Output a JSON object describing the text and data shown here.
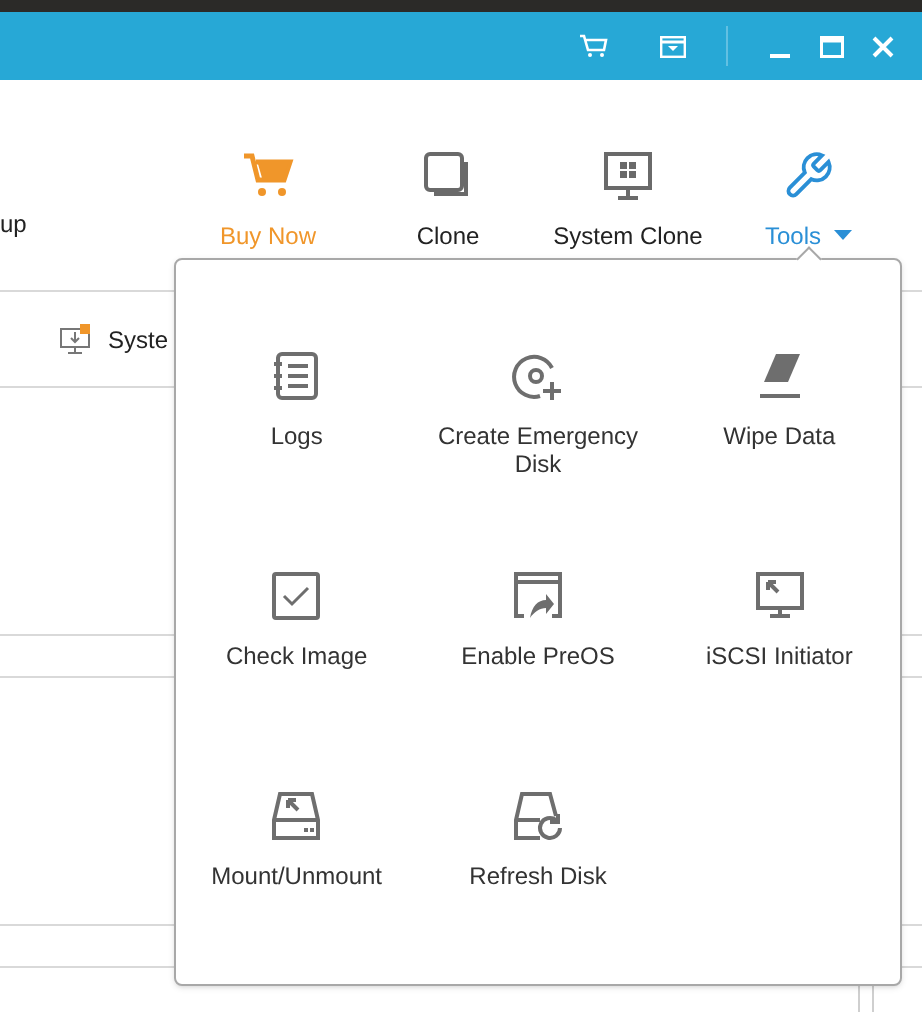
{
  "toolbar": {
    "left_label": "up",
    "items": [
      {
        "label": "Buy Now",
        "kind": "promo",
        "selected": false
      },
      {
        "label": "Clone",
        "kind": "plain",
        "selected": false
      },
      {
        "label": "System Clone",
        "kind": "plain",
        "selected": false
      },
      {
        "label": "Tools",
        "kind": "dropdown",
        "selected": true
      }
    ]
  },
  "tab": {
    "label": "Syste"
  },
  "tools_menu": {
    "items": [
      {
        "label": "Logs"
      },
      {
        "label": "Create Emergency Disk"
      },
      {
        "label": "Wipe Data"
      },
      {
        "label": "Check Image"
      },
      {
        "label": "Enable PreOS"
      },
      {
        "label": "iSCSI Initiator"
      },
      {
        "label": "Mount/Unmount"
      },
      {
        "label": "Refresh Disk"
      }
    ]
  }
}
